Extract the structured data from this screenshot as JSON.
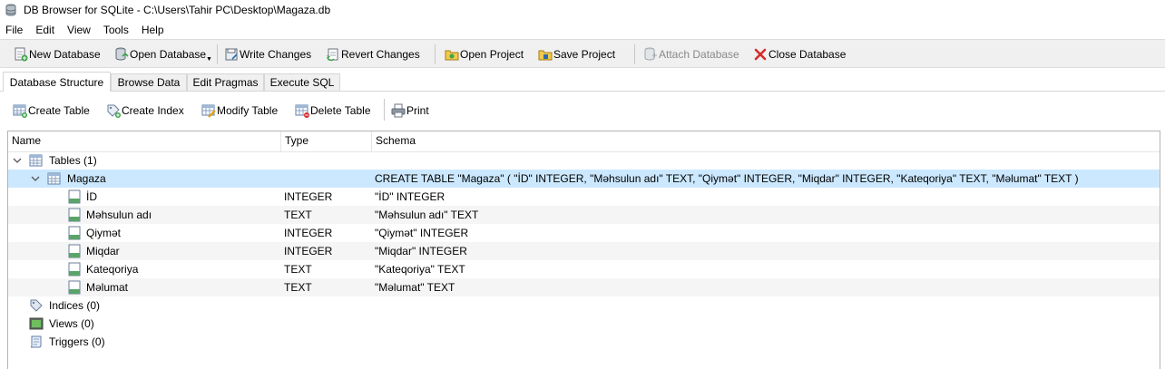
{
  "window": {
    "title": "DB Browser for SQLite - C:\\Users\\Tahir PC\\Desktop\\Magaza.db"
  },
  "menu": [
    "File",
    "Edit",
    "View",
    "Tools",
    "Help"
  ],
  "toolbar": {
    "new_database": "New Database",
    "open_database": "Open Database",
    "write_changes": "Write Changes",
    "revert_changes": "Revert Changes",
    "open_project": "Open Project",
    "save_project": "Save Project",
    "attach_database": "Attach Database",
    "close_database": "Close Database"
  },
  "tabs": [
    "Database Structure",
    "Browse Data",
    "Edit Pragmas",
    "Execute SQL"
  ],
  "structure_toolbar": {
    "create_table": "Create Table",
    "create_index": "Create Index",
    "modify_table": "Modify Table",
    "delete_table": "Delete Table",
    "print": "Print"
  },
  "tree": {
    "columns": [
      "Name",
      "Type",
      "Schema"
    ],
    "tables_label": "Tables (1)",
    "table": {
      "name": "Magaza",
      "schema": "CREATE TABLE \"Magaza\" ( \"İD\" INTEGER, \"Məhsulun adı\" TEXT, \"Qiymət\" INTEGER, \"Miqdar\" INTEGER, \"Kateqoriya\" TEXT, \"Məlumat\" TEXT )",
      "fields": [
        {
          "name": "İD",
          "type": "INTEGER",
          "schema": "\"İD\" INTEGER"
        },
        {
          "name": "Məhsulun adı",
          "type": "TEXT",
          "schema": "\"Məhsulun adı\" TEXT"
        },
        {
          "name": "Qiymət",
          "type": "INTEGER",
          "schema": "\"Qiymət\" INTEGER"
        },
        {
          "name": "Miqdar",
          "type": "INTEGER",
          "schema": "\"Miqdar\" INTEGER"
        },
        {
          "name": "Kateqoriya",
          "type": "TEXT",
          "schema": "\"Kateqoriya\" TEXT"
        },
        {
          "name": "Məlumat",
          "type": "TEXT",
          "schema": "\"Məlumat\" TEXT"
        }
      ]
    },
    "indices_label": "Indices (0)",
    "views_label": "Views (0)",
    "triggers_label": "Triggers (0)"
  },
  "colors": {
    "selection": "#cce8ff",
    "close_icon": "#d62b2b",
    "disabled_text": "#8a8a8a"
  }
}
